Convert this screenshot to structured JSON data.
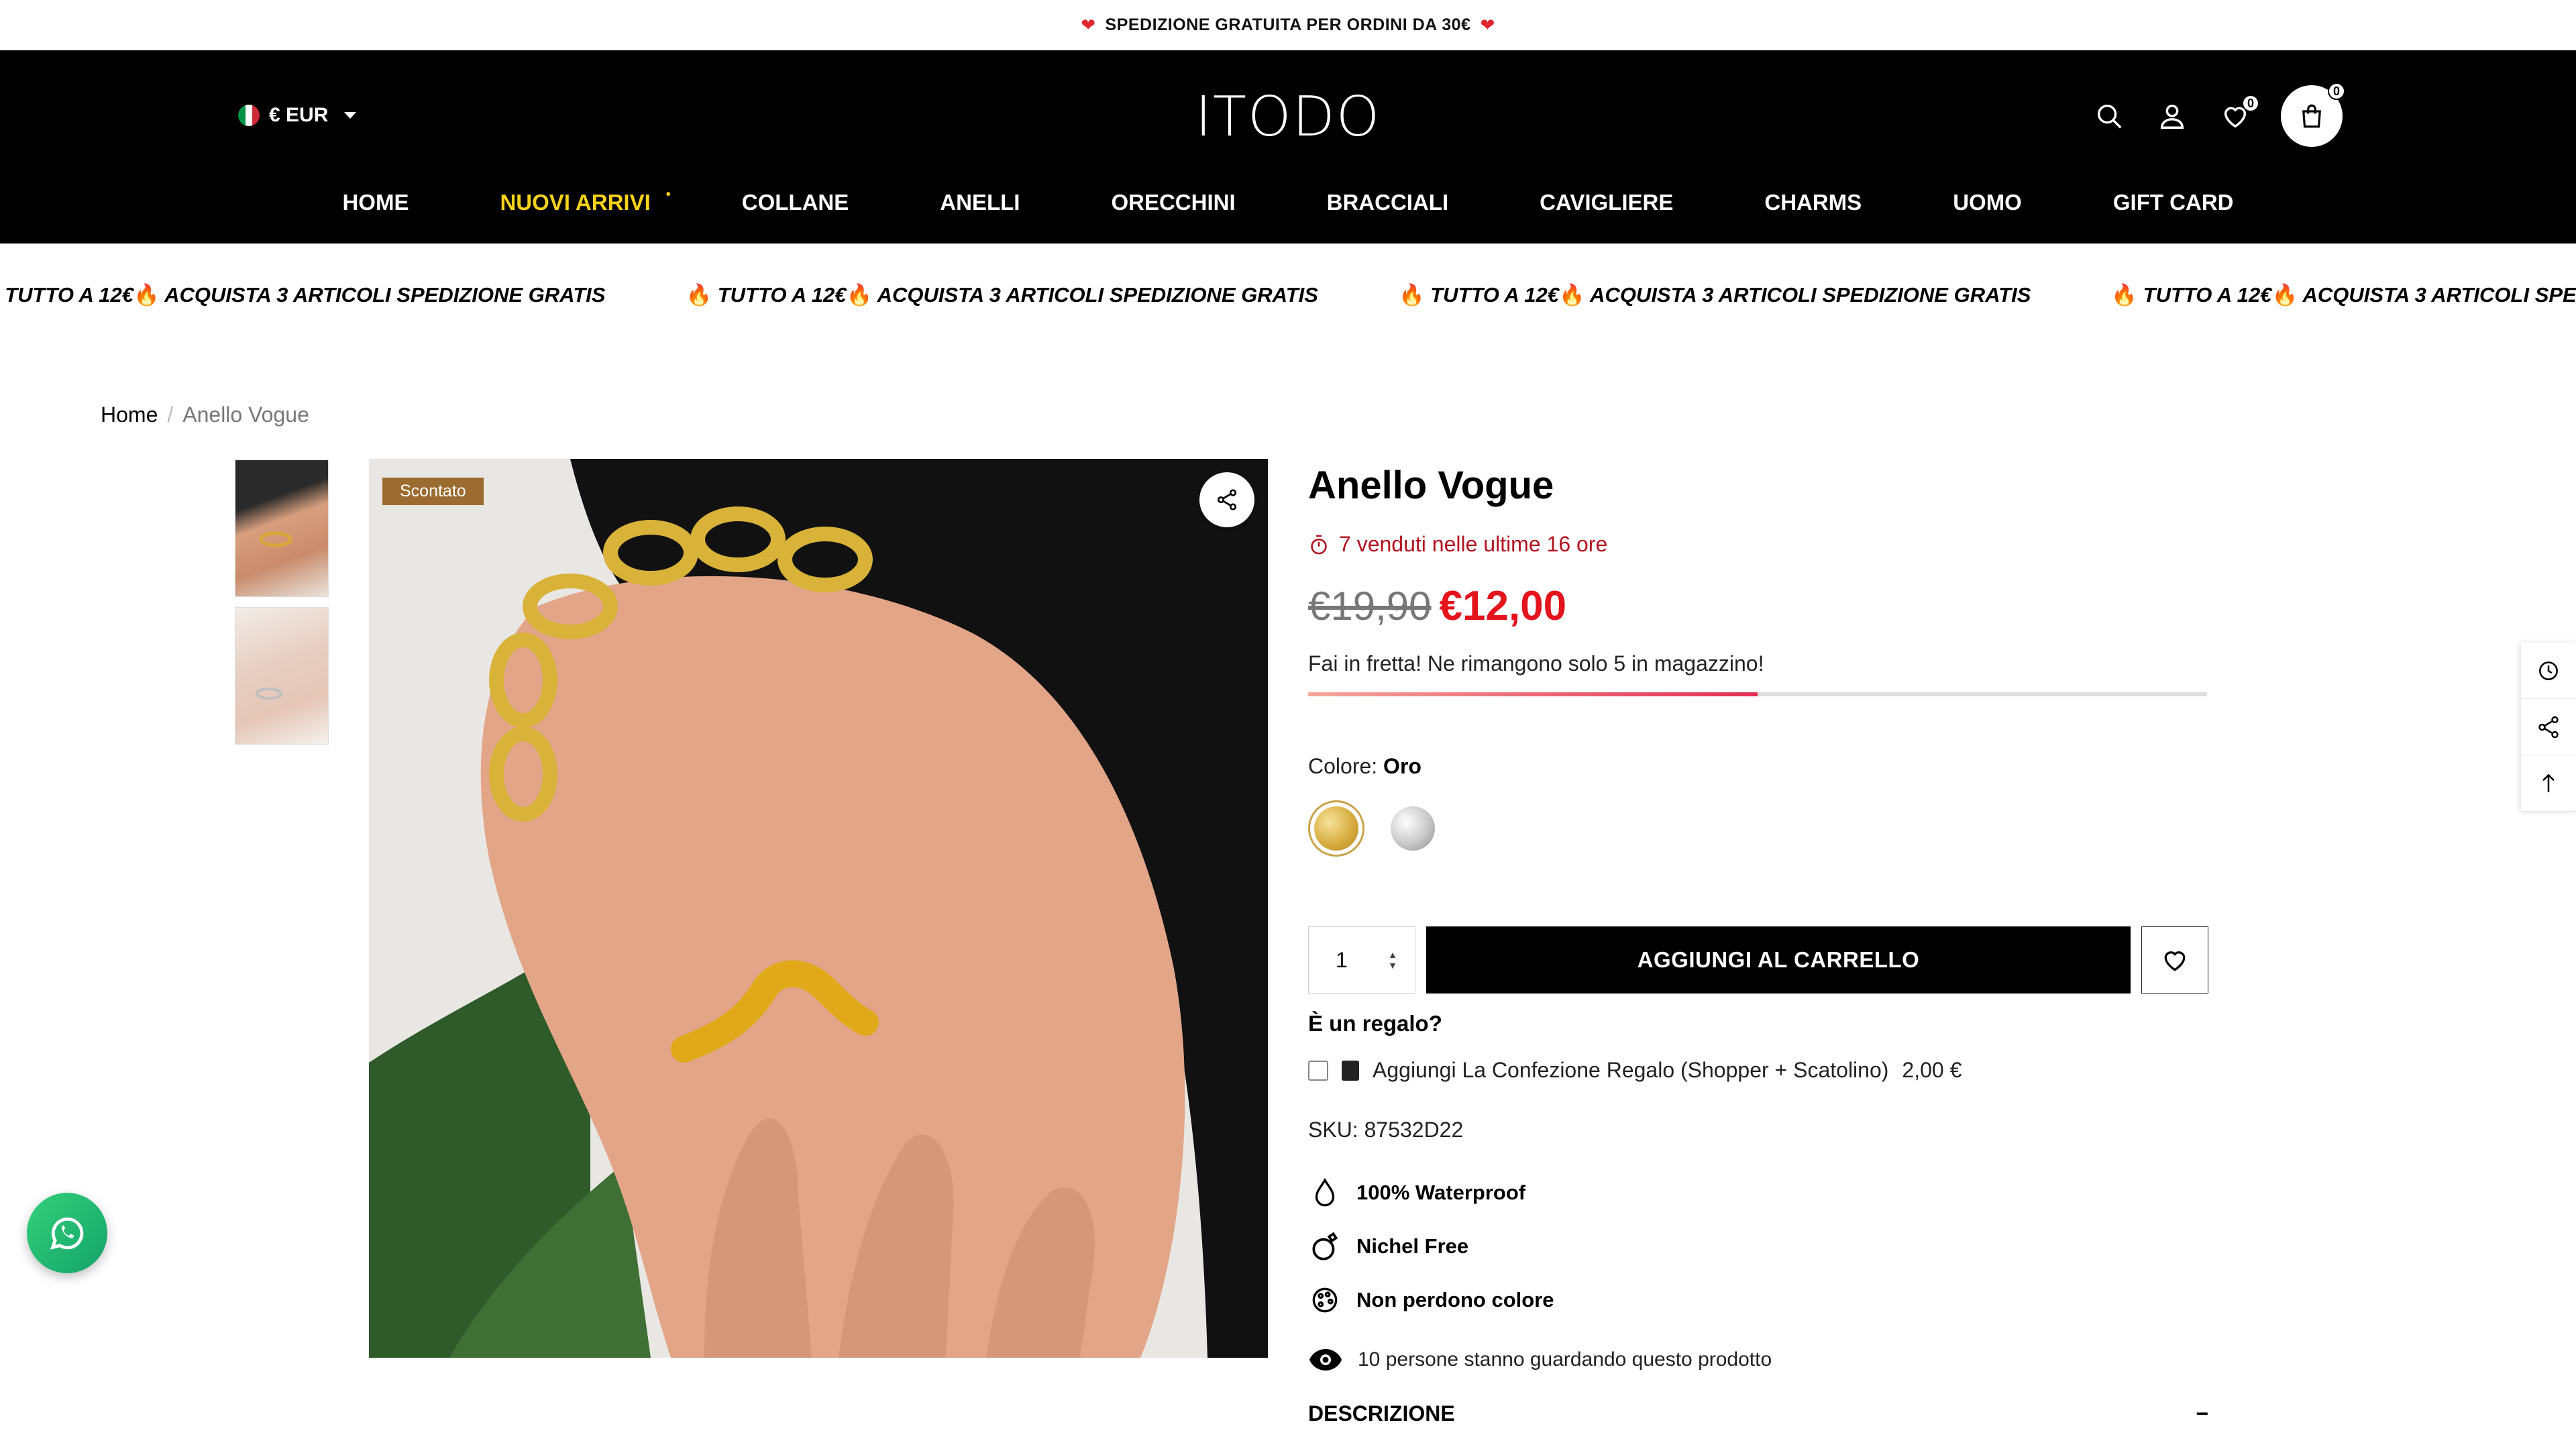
{
  "announcement": {
    "text": "SPEDIZIONE GRATUITA PER ORDINI DA 30€"
  },
  "header": {
    "currency": "€ EUR",
    "logo": "ITODO",
    "wishlist_count": "0",
    "cart_count": "0"
  },
  "nav": [
    {
      "label": "HOME",
      "active": false
    },
    {
      "label": "NUOVI ARRIVI",
      "active": true
    },
    {
      "label": "COLLANE",
      "active": false
    },
    {
      "label": "ANELLI",
      "active": false
    },
    {
      "label": "ORECCHINI",
      "active": false
    },
    {
      "label": "BRACCIALI",
      "active": false
    },
    {
      "label": "CAVIGLIERE",
      "active": false
    },
    {
      "label": "CHARMS",
      "active": false
    },
    {
      "label": "UOMO",
      "active": false
    },
    {
      "label": "GIFT CARD",
      "active": false
    }
  ],
  "marquee": {
    "part1": "TUTTO A 12€",
    "part2": "ACQUISTA 3 ARTICOLI SPEDIZIONE GRATIS"
  },
  "breadcrumb": {
    "home": "Home",
    "separator": "/",
    "current": "Anello Vogue"
  },
  "media": {
    "badge": "Scontato"
  },
  "product": {
    "title": "Anello Vogue",
    "sold_text": "7 venduti nelle ultime 16 ore",
    "price_old": "€19,90",
    "price_new": "€12,00",
    "stock_text": "Fai in fretta! Ne rimangono solo 5 in magazzino!",
    "stock_fraction": 0.5,
    "color_label": "Colore:",
    "color_value": "Oro",
    "quantity": "1",
    "add_to_cart": "AGGIUNGI AL CARRELLO",
    "gift_question": "È un regalo?",
    "gift_option": "Aggiungi La Confezione Regalo (Shopper + Scatolino)",
    "gift_price": "2,00 €",
    "sku_label": "SKU:",
    "sku_value": "87532D22",
    "features": [
      "100% Waterproof",
      "Nichel Free",
      "Non perdono colore"
    ],
    "viewers_text": "10 persone stanno guardando questo prodotto",
    "description_label": "DESCRIZIONE",
    "description_toggle": "−"
  },
  "colors": {
    "accent_red": "#e3141c",
    "badge": "#9b6b2f",
    "active_nav": "#f7d21a"
  }
}
